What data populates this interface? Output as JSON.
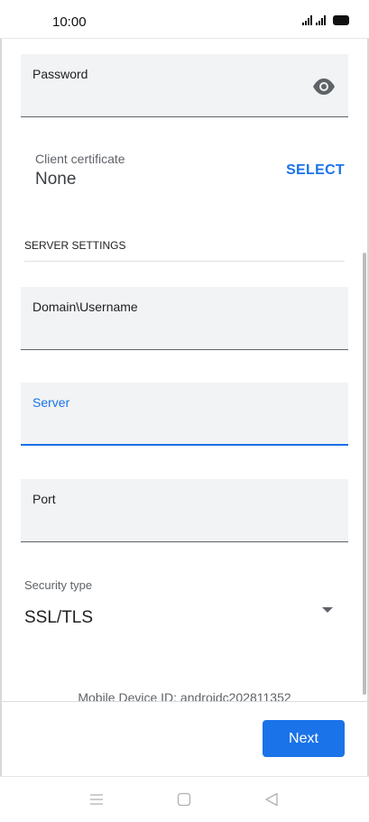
{
  "status_bar": {
    "time": "10:00"
  },
  "form": {
    "password": {
      "label": "Password",
      "value": ""
    },
    "client_certificate": {
      "label": "Client certificate",
      "value": "None",
      "action": "SELECT"
    },
    "server_settings_header": "SERVER SETTINGS",
    "domain_username": {
      "label": "Domain\\Username",
      "value": ""
    },
    "server": {
      "label": "Server",
      "value": ""
    },
    "port": {
      "label": "Port",
      "value": ""
    },
    "security_type": {
      "label": "Security type",
      "value": "SSL/TLS"
    }
  },
  "footer": {
    "device_id": "Mobile Device ID: androidc202811352",
    "next_label": "Next"
  },
  "colors": {
    "accent": "#1a73e8",
    "field_bg": "#f1f3f4"
  },
  "icons": [
    "eye-icon",
    "dropdown-arrow-icon",
    "menu-icon",
    "home-icon",
    "back-icon"
  ]
}
